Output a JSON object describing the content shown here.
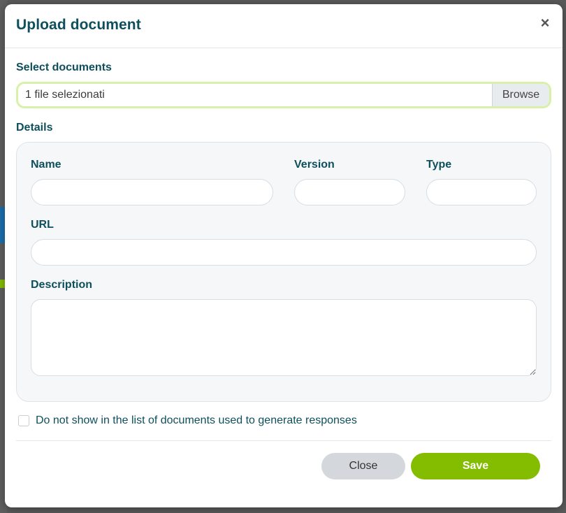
{
  "modal": {
    "title": "Upload document",
    "close_icon": "close-icon",
    "close_glyph": "×"
  },
  "select_documents": {
    "label": "Select documents",
    "file_text": "1 file selezionati",
    "browse_label": "Browse"
  },
  "details": {
    "label": "Details",
    "name_label": "Name",
    "name_value": "",
    "version_label": "Version",
    "version_value": "",
    "type_label": "Type",
    "type_value": "",
    "url_label": "URL",
    "url_value": "",
    "description_label": "Description",
    "description_value": ""
  },
  "checkbox": {
    "label": "Do not show in the list of documents used to generate responses",
    "checked": false
  },
  "footer": {
    "close_label": "Close",
    "save_label": "Save"
  },
  "colors": {
    "heading": "#0e4f5c",
    "save": "#84bd00",
    "close_button": "#d4d8dd",
    "focus_ring": "#d9f0a8"
  }
}
